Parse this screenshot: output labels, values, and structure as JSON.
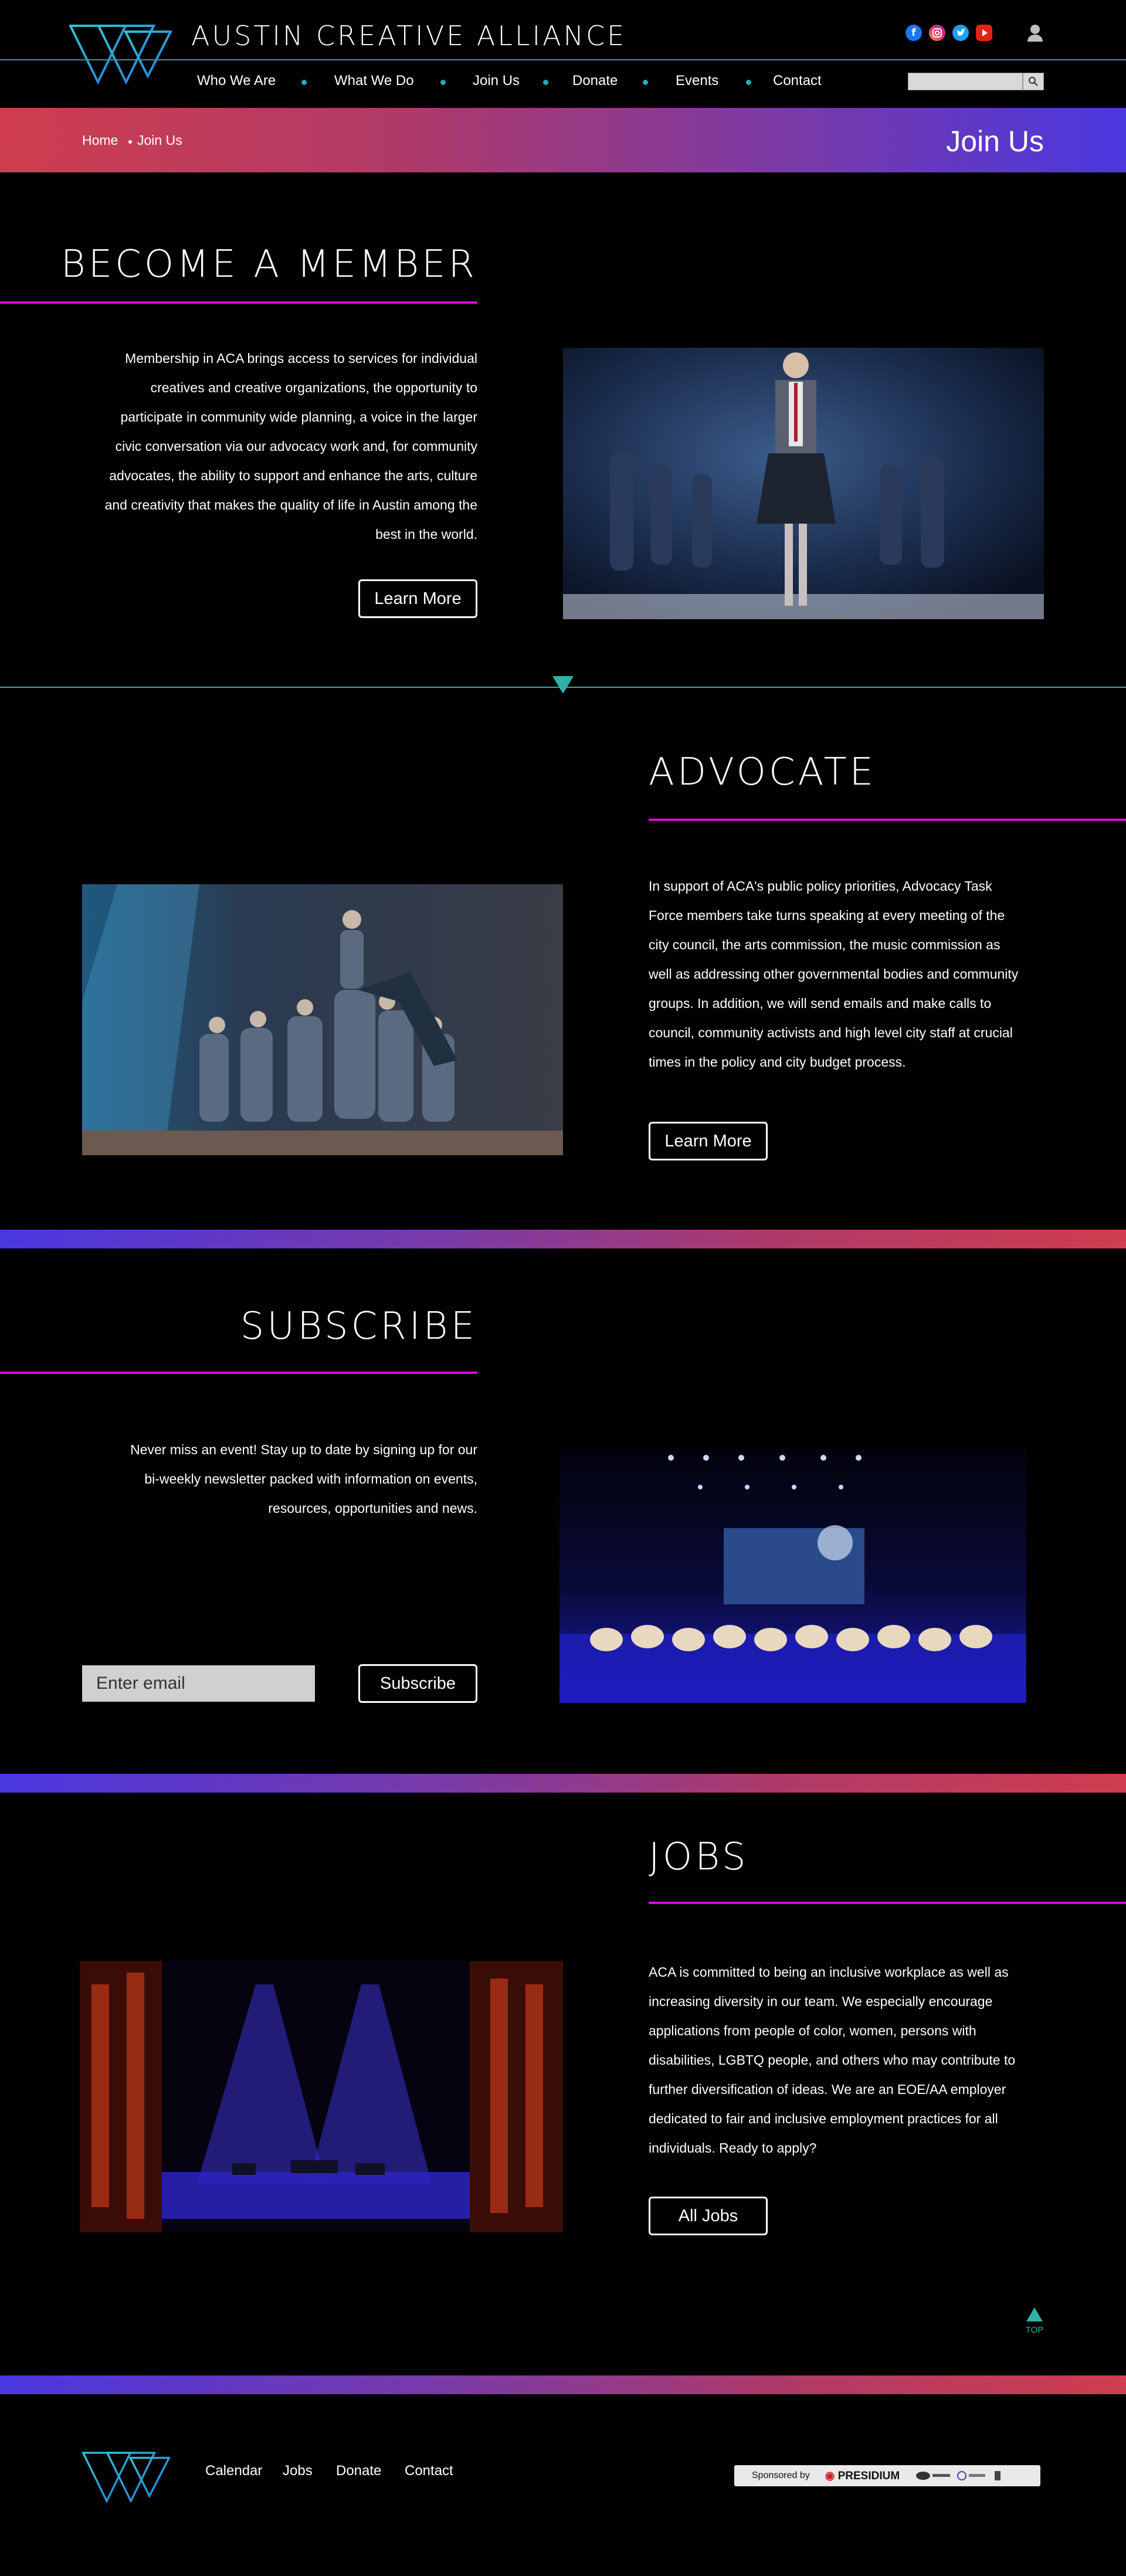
{
  "site": {
    "title": "AUSTIN CREATIVE ALLIANCE"
  },
  "nav": {
    "items": [
      {
        "label": "Who We Are"
      },
      {
        "label": "What We Do"
      },
      {
        "label": "Join Us"
      },
      {
        "label": "Donate"
      },
      {
        "label": "Events"
      },
      {
        "label": "Contact"
      }
    ],
    "search_placeholder": ""
  },
  "breadcrumb": {
    "home": "Home",
    "current": "Join Us"
  },
  "banner": {
    "title": "Join Us"
  },
  "sections": {
    "member": {
      "title": "BECOME A MEMBER",
      "lines": [
        "Membership in ACA brings access to services for individual",
        "creatives and creative organizations, the opportunity to",
        "participate in community wide planning, a voice in the larger",
        "civic conversation via our advocacy work and, for community",
        "advocates, the ability to support and enhance the arts, culture",
        "and creativity that makes the quality of life in Austin among the",
        "best in the world."
      ],
      "button": "Learn More"
    },
    "advocate": {
      "title": "ADVOCATE",
      "lines": [
        "In support of ACA's public policy priorities, Advocacy Task",
        "Force members take turns speaking at every meeting of the",
        "city council, the arts commission, the music commission as",
        "well as addressing other governmental bodies and community",
        "groups. In addition, we will send emails and make calls to",
        "council, community activists and high level city staff at crucial",
        "times in the policy and city budget process."
      ],
      "button": "Learn More"
    },
    "subscribe": {
      "title": "SUBSCRIBE",
      "lines": [
        "Never miss an event! Stay up to date by signing up for our",
        "bi-weekly newsletter packed with information on events,",
        "resources, opportunities and news."
      ],
      "email_placeholder": "Enter email",
      "button": "Subscribe"
    },
    "jobs": {
      "title": "JOBS",
      "lines": [
        "ACA is committed to being an inclusive workplace as well as",
        "increasing diversity in our team. We especially encourage",
        "applications from people of color, women, persons with",
        "disabilities, LGBTQ people, and others who may contribute to",
        "further diversification of ideas. We are an EOE/AA employer",
        "dedicated to fair and inclusive employment practices for all",
        "individuals. Ready to apply?"
      ],
      "button": "All Jobs"
    }
  },
  "top_button": {
    "label": "TOP"
  },
  "footer": {
    "links": [
      {
        "label": "Calendar"
      },
      {
        "label": "Jobs"
      },
      {
        "label": "Donate"
      },
      {
        "label": "Contact"
      }
    ],
    "sponsor_label": "Sponsored by",
    "sponsor_name": "PRESIDIUM"
  },
  "colors": {
    "accent_teal": "#2fb1a7",
    "accent_magenta": "#d10fd7",
    "gradient_red": "#cf3d4f",
    "gradient_blue": "#4a37e0"
  },
  "icons": [
    "logo-triangles",
    "facebook-icon",
    "instagram-icon",
    "twitter-icon",
    "youtube-icon",
    "user-icon",
    "search-icon",
    "triangle-down-icon",
    "arrow-up-icon"
  ]
}
